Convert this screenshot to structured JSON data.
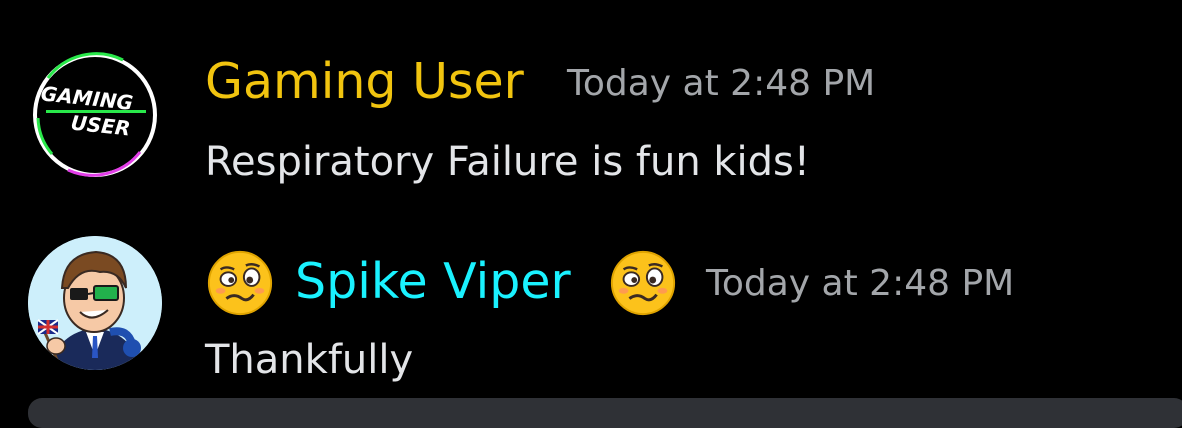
{
  "messages": [
    {
      "author": "Gaming User",
      "author_color": "#f1c40f",
      "timestamp": "Today at 2:48 PM",
      "text": "Respiratory Failure is fun kids!",
      "avatar": {
        "icon": "gaming-user-logo-icon",
        "lines": [
          "GAMING",
          "USER"
        ]
      }
    },
    {
      "author": "Spike Viper",
      "author_color": "#1af2ff",
      "name_emoji": "woozy-face-icon",
      "timestamp": "Today at 2:48 PM",
      "text": "Thankfully",
      "avatar": {
        "icon": "cartoon-character-avatar-icon"
      }
    }
  ],
  "colors": {
    "background": "#000000",
    "text": "#e3e5e8",
    "timestamp": "#a3a6aa"
  }
}
